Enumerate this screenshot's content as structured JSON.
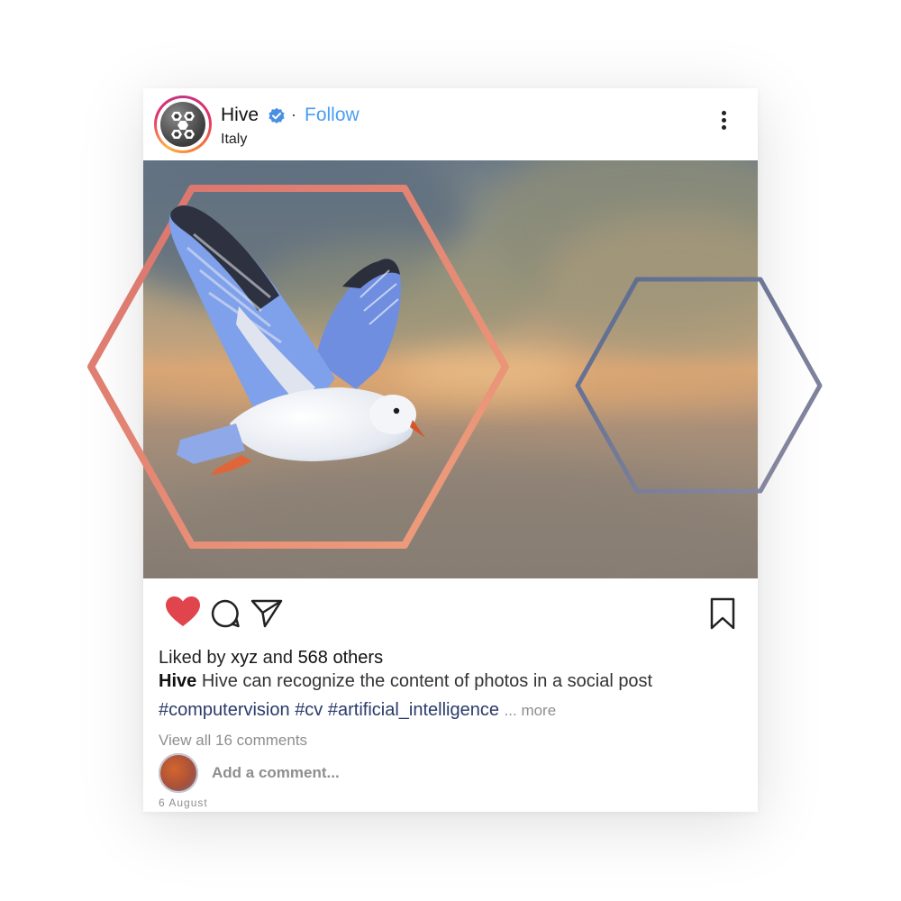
{
  "post": {
    "author": "Hive",
    "follow_label": "Follow",
    "separator": "·",
    "location": "Italy",
    "icons": {
      "avatar": "hive-logo-icon",
      "verified": "verified-badge-icon",
      "menu": "more-options-icon",
      "like": "heart-icon",
      "comment": "comment-icon",
      "share": "share-icon",
      "save": "bookmark-icon"
    },
    "liked_by": {
      "prefix": "Liked by",
      "user": "xyz",
      "joiner": "and",
      "others": "568 others"
    },
    "caption": {
      "user": "Hive",
      "text": "Hive can recognize the content of photos in a social post"
    },
    "hashtags": [
      "#computervision",
      "#cv",
      "#artificial_intelligence"
    ],
    "more_label": "... more",
    "view_comments": "View all 16 comments",
    "add_comment_placeholder": "Add a comment...",
    "date": "6 August"
  },
  "colors": {
    "like": "#e0454e",
    "follow": "#4a9ef0",
    "hashtag": "#2b3a6b",
    "hexagon_primary": "#e8806a",
    "hexagon_secondary": "#6a7a95"
  }
}
